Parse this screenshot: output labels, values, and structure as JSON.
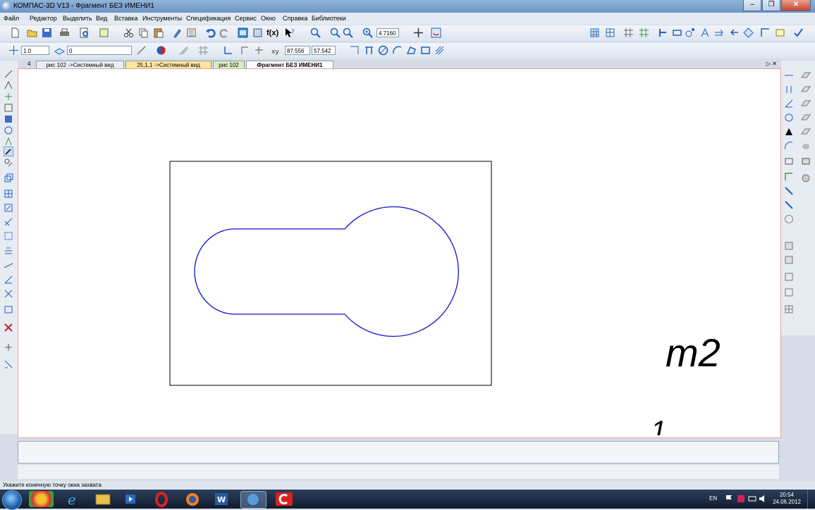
{
  "window": {
    "title": "КОМПАС-3D V13 - Фрагмент БЕЗ ИМЕНИ1",
    "minimize": "–",
    "restore": "❐",
    "close": "✕"
  },
  "menu": [
    "Файл",
    "Редактор",
    "Выделить",
    "Вид",
    "Вставка",
    "Инструменты",
    "Спецификация",
    "Сервис",
    "Окно",
    "Справка",
    "Библиотеки"
  ],
  "toolbar": {
    "zoom_value": "4.7160",
    "line_scale": "1.0",
    "layer_value": "0",
    "coord_x": "87.556",
    "coord_y": "57.542",
    "fx_label": "f(x)"
  },
  "tabs": {
    "scroll_left": "4",
    "items": [
      "рис 102 ->Системный вид",
      "25,1,1 ->Системный вид",
      "рис 102",
      "Фрагмент БЕЗ ИМЕНИ1"
    ],
    "controls": "▷ ✕"
  },
  "canvas_text": {
    "t2": "т2",
    "stray": "1"
  },
  "status": {
    "prompt": "Укажите конечную точку окна захвата"
  },
  "tray": {
    "lang": "EN",
    "time": "20:54",
    "date": "24.06.2012"
  },
  "colors": {
    "contour": "#1010d0",
    "active_tab": "#ffffff",
    "tab_yellow": "#ffe69a",
    "tab_green": "#d8ecc0"
  }
}
